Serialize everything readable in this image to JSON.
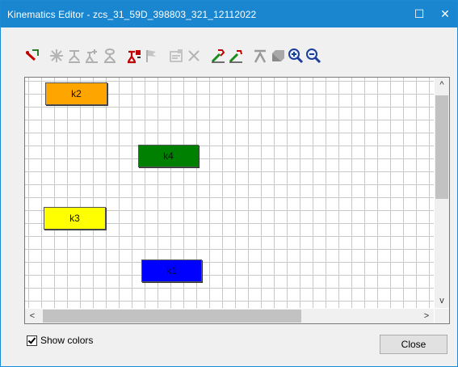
{
  "window": {
    "title": "Kinematics Editor -  zcs_31_59D_398803_321_12112022",
    "maximize_glyph": "☐",
    "close_glyph": "✕"
  },
  "toolbar": {
    "icons": [
      "pen-edit-icon",
      "star-disabled-icon",
      "joint-disabled-icon",
      "joint-add-disabled-icon",
      "joint-link-disabled-icon",
      "red-joint-icon",
      "flag-disabled-icon",
      "properties-disabled-icon",
      "delete-disabled-icon",
      "tool-green-icon",
      "tool-green-2-icon",
      "align-disabled-icon",
      "frame-disabled-icon",
      "zoom-in-icon",
      "zoom-out-icon"
    ]
  },
  "canvas": {
    "nodes": [
      {
        "label": "k2",
        "color": "#ffa500"
      },
      {
        "label": "k4",
        "color": "#008000"
      },
      {
        "label": "k3",
        "color": "#ffff00"
      },
      {
        "label": "k1",
        "color": "#0000ff"
      }
    ],
    "scroll_up": "^",
    "scroll_down": "v",
    "scroll_left": "<",
    "scroll_right": ">"
  },
  "footer": {
    "show_colors_label": "Show colors",
    "show_colors_checked": true,
    "close_label": "Close"
  }
}
